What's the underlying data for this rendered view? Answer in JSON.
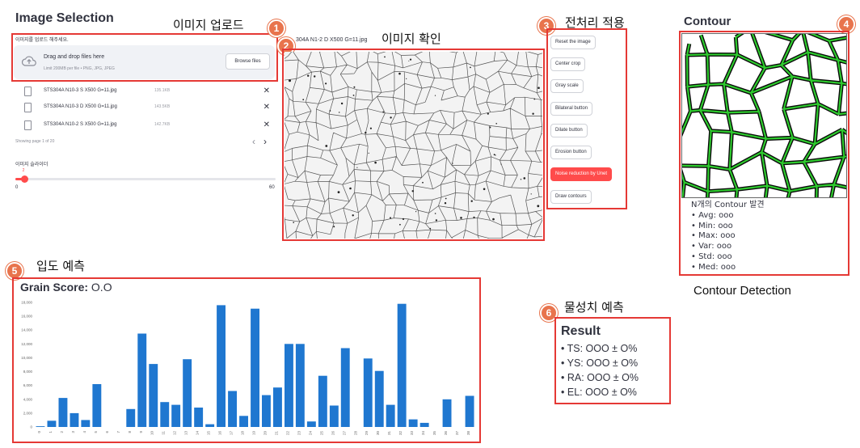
{
  "upload": {
    "title": "Image Selection",
    "annotation": "이미지 업로드",
    "prompt": "이미지를 업로드 해주세요.",
    "drop_main": "Drag and drop files here",
    "drop_sub": "Limit 200MB per file • PNG, JPG, JPEG",
    "browse_label": "Browse files",
    "files": [
      {
        "name": "STS304A N10-3 S X500 G=11.jpg",
        "size": "135.1KB"
      },
      {
        "name": "STS304A N10-3 D X500 G=11.jpg",
        "size": "143.5KB"
      },
      {
        "name": "STS304A N10-2 S X500 G=11.jpg",
        "size": "142.7KB"
      }
    ],
    "pagination": "Showing page 1 of 20",
    "prev_icon": "‹",
    "next_icon": "›",
    "slider_label": "이미지 슬라이더",
    "slider_value": "2",
    "slider_min": "0",
    "slider_max": "60",
    "slider_fraction": 0.033
  },
  "preview": {
    "annotation": "이미지 확인",
    "caption": "304A N1-2 D X500 G=11.jpg"
  },
  "preprocess": {
    "annotation": "전처리 적용",
    "buttons": [
      "Reset the image",
      "Center crop",
      "Gray scale",
      "Bilateral button",
      "Dilate button",
      "Erosion button",
      "Noise reduction by Unet",
      "Draw contours"
    ],
    "active_index": 6
  },
  "contour": {
    "title": "Contour",
    "annotation": "Contour Detection",
    "found": "N개의 Contour 발견",
    "stats": [
      "Avg: ooo",
      "Min: ooo",
      "Max: ooo",
      "Var: ooo",
      "Std: ooo",
      "Med: ooo"
    ]
  },
  "grain": {
    "annotation": "입도 예측",
    "title_label": "Grain Score:",
    "title_value": "O.O"
  },
  "property": {
    "annotation": "물성치 예측",
    "title": "Result",
    "items": [
      "TS: OOO  ±  O%",
      "YS: OOO  ±  O%",
      "RA: OOO  ±  O%",
      "EL:  OOO  ±  O%"
    ]
  },
  "badges": [
    "1",
    "2",
    "3",
    "4",
    "5",
    "6"
  ],
  "colors": {
    "accent": "#ff4b4b",
    "annotation_red": "#e53935",
    "badge": "#e8744d",
    "bar": "#1f77d0",
    "contour_green": "#2ecc2e"
  },
  "chart_data": {
    "type": "bar",
    "categories": [
      "0",
      "1",
      "2",
      "3",
      "4",
      "5",
      "6",
      "7",
      "8",
      "9",
      "10",
      "11",
      "12",
      "13",
      "14",
      "15",
      "16",
      "17",
      "18",
      "19",
      "20",
      "21",
      "22",
      "23",
      "24",
      "25",
      "26",
      "27",
      "28",
      "29",
      "30",
      "31",
      "32",
      "33",
      "34",
      "35",
      "36",
      "37",
      "38"
    ],
    "values": [
      100,
      900,
      4200,
      2000,
      1000,
      6200,
      0,
      0,
      2600,
      13500,
      9100,
      3600,
      3200,
      9800,
      2800,
      400,
      17600,
      5200,
      1600,
      17100,
      4600,
      5700,
      12000,
      12000,
      800,
      7400,
      3100,
      11400,
      0,
      9900,
      8100,
      3200,
      17800,
      1100,
      600,
      0,
      4000,
      0,
      4500
    ],
    "ylim": [
      0,
      18000
    ],
    "yticks": [
      "0",
      "2,000",
      "4,000",
      "6,000",
      "8,000",
      "10,000",
      "12,000",
      "14,000",
      "16,000",
      "18,000"
    ],
    "grid": false
  }
}
